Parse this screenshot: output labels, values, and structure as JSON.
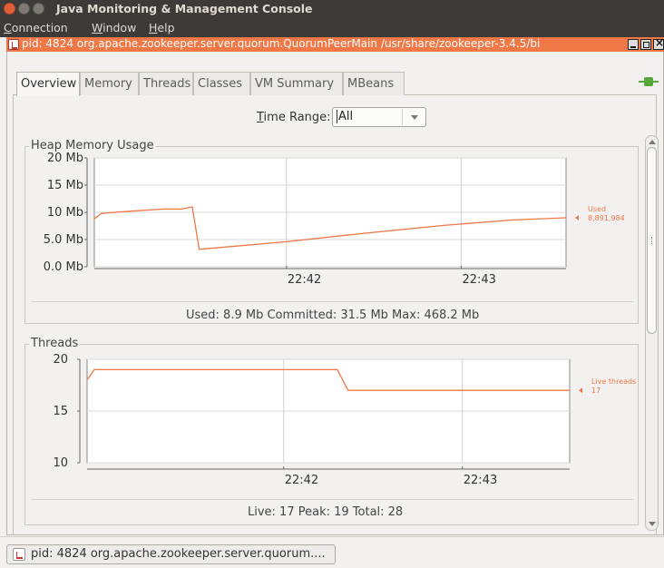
{
  "window": {
    "title": "Java Monitoring & Management Console"
  },
  "menubar": {
    "items": [
      {
        "label_first": "C",
        "label_rest": "onnection"
      },
      {
        "label_first": "W",
        "label_rest": "indow"
      },
      {
        "label_first": "H",
        "label_rest": "elp"
      }
    ]
  },
  "internal_frame": {
    "title": "pid: 4824 org.apache.zookeeper.server.quorum.QuorumPeerMain /usr/share/zookeeper-3.4.5/bi"
  },
  "tabs": [
    "Overview",
    "Memory",
    "Threads",
    "Classes",
    "VM Summary",
    "MBeans"
  ],
  "time_range": {
    "label_first": "T",
    "label_rest": "ime Range:",
    "selected": "All"
  },
  "heap_panel": {
    "title": "Heap Memory Usage",
    "stats": "Used: 8.9 Mb   Committed: 31.5 Mb   Max: 468.2 Mb"
  },
  "threads_panel": {
    "title": "Threads",
    "stats": "Live: 17   Peak: 19   Total: 28"
  },
  "taskbar": {
    "label": "pid: 4824 org.apache.zookeeper.server.quorum...."
  },
  "colors": {
    "series": "#f07746",
    "titlebar": "#3c3b37",
    "frame_title": "#f07746",
    "connected_icon": "#55a83a"
  },
  "chart_data": [
    {
      "type": "line",
      "title": "Heap Memory Usage",
      "yticks": [
        "20 Mb",
        "15 Mb",
        "10 Mb",
        "5.0 Mb",
        "0.0 Mb"
      ],
      "ylim": [
        0,
        20
      ],
      "xticks": [
        "22:42",
        "22:43"
      ],
      "grid": true,
      "series": [
        {
          "name": "Used",
          "value_label": "8,891,984",
          "points": [
            [
              0,
              8.8
            ],
            [
              0.02,
              9.8
            ],
            [
              0.1,
              10.2
            ],
            [
              0.2,
              10.6
            ],
            [
              0.25,
              10.6
            ],
            [
              0.28,
              11.0
            ],
            [
              0.3,
              3.2
            ],
            [
              0.55,
              4.6
            ],
            [
              0.75,
              6.0
            ],
            [
              1.0,
              7.6
            ],
            [
              1.2,
              8.6
            ],
            [
              1.35,
              9.0
            ]
          ],
          "x_ref_ticks": [
            0.55,
            1.05
          ]
        }
      ]
    },
    {
      "type": "line",
      "title": "Threads",
      "yticks": [
        "20",
        "15",
        "10"
      ],
      "ylim": [
        10,
        20
      ],
      "xticks": [
        "22:42",
        "22:43"
      ],
      "grid": true,
      "series": [
        {
          "name": "Live threads",
          "value_label": "17",
          "points": [
            [
              0,
              18
            ],
            [
              0.02,
              19
            ],
            [
              0.7,
              19
            ],
            [
              0.73,
              17
            ],
            [
              1.0,
              17
            ],
            [
              1.35,
              17
            ]
          ],
          "x_ref_ticks": [
            0.55,
            1.05
          ]
        }
      ]
    }
  ]
}
